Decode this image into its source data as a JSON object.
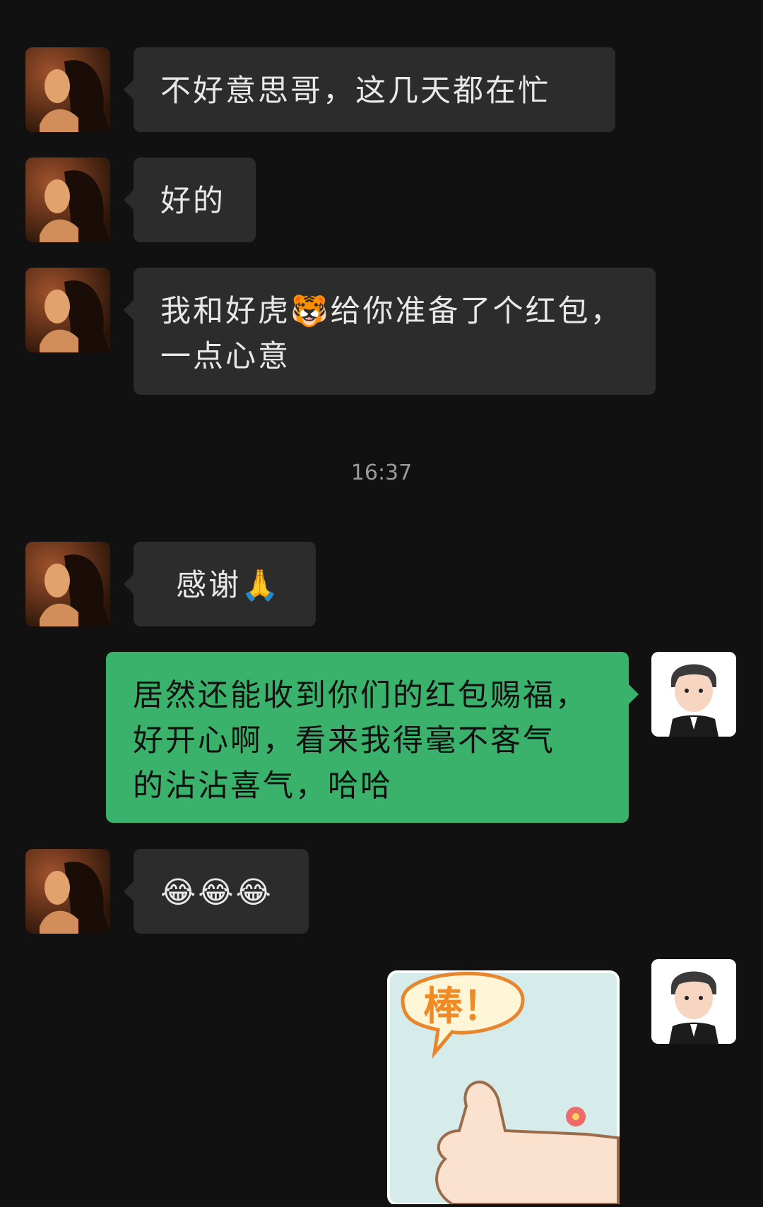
{
  "messages": [
    {
      "id": "m1",
      "side": "left",
      "text": "不好意思哥，这几天都在忙"
    },
    {
      "id": "m2",
      "side": "left",
      "text": "好的"
    },
    {
      "id": "m3",
      "side": "left",
      "line1": "我和好虎🐯给你准备了个红包，",
      "line2": "一点心意"
    },
    {
      "id": "m4",
      "side": "left",
      "text": "感谢🙏"
    },
    {
      "id": "m5",
      "side": "right",
      "line1": "居然还能收到你们的红包赐福，",
      "line2": "好开心啊，看来我得毫不客气",
      "line3": "的沾沾喜气，哈哈"
    },
    {
      "id": "m6",
      "side": "left",
      "text": "😂😂😂"
    },
    {
      "id": "m7",
      "side": "right",
      "sticker_text": "棒！"
    }
  ],
  "timestamp": "16:37",
  "colors": {
    "background": "#111111",
    "left_bubble": "#2c2c2c",
    "right_bubble": "#3bb26c"
  },
  "icons": {
    "contact_avatar": "woman-portrait",
    "self_avatar": "cartoon-man-avatar",
    "sticker": "thumbs-up-sticker"
  }
}
